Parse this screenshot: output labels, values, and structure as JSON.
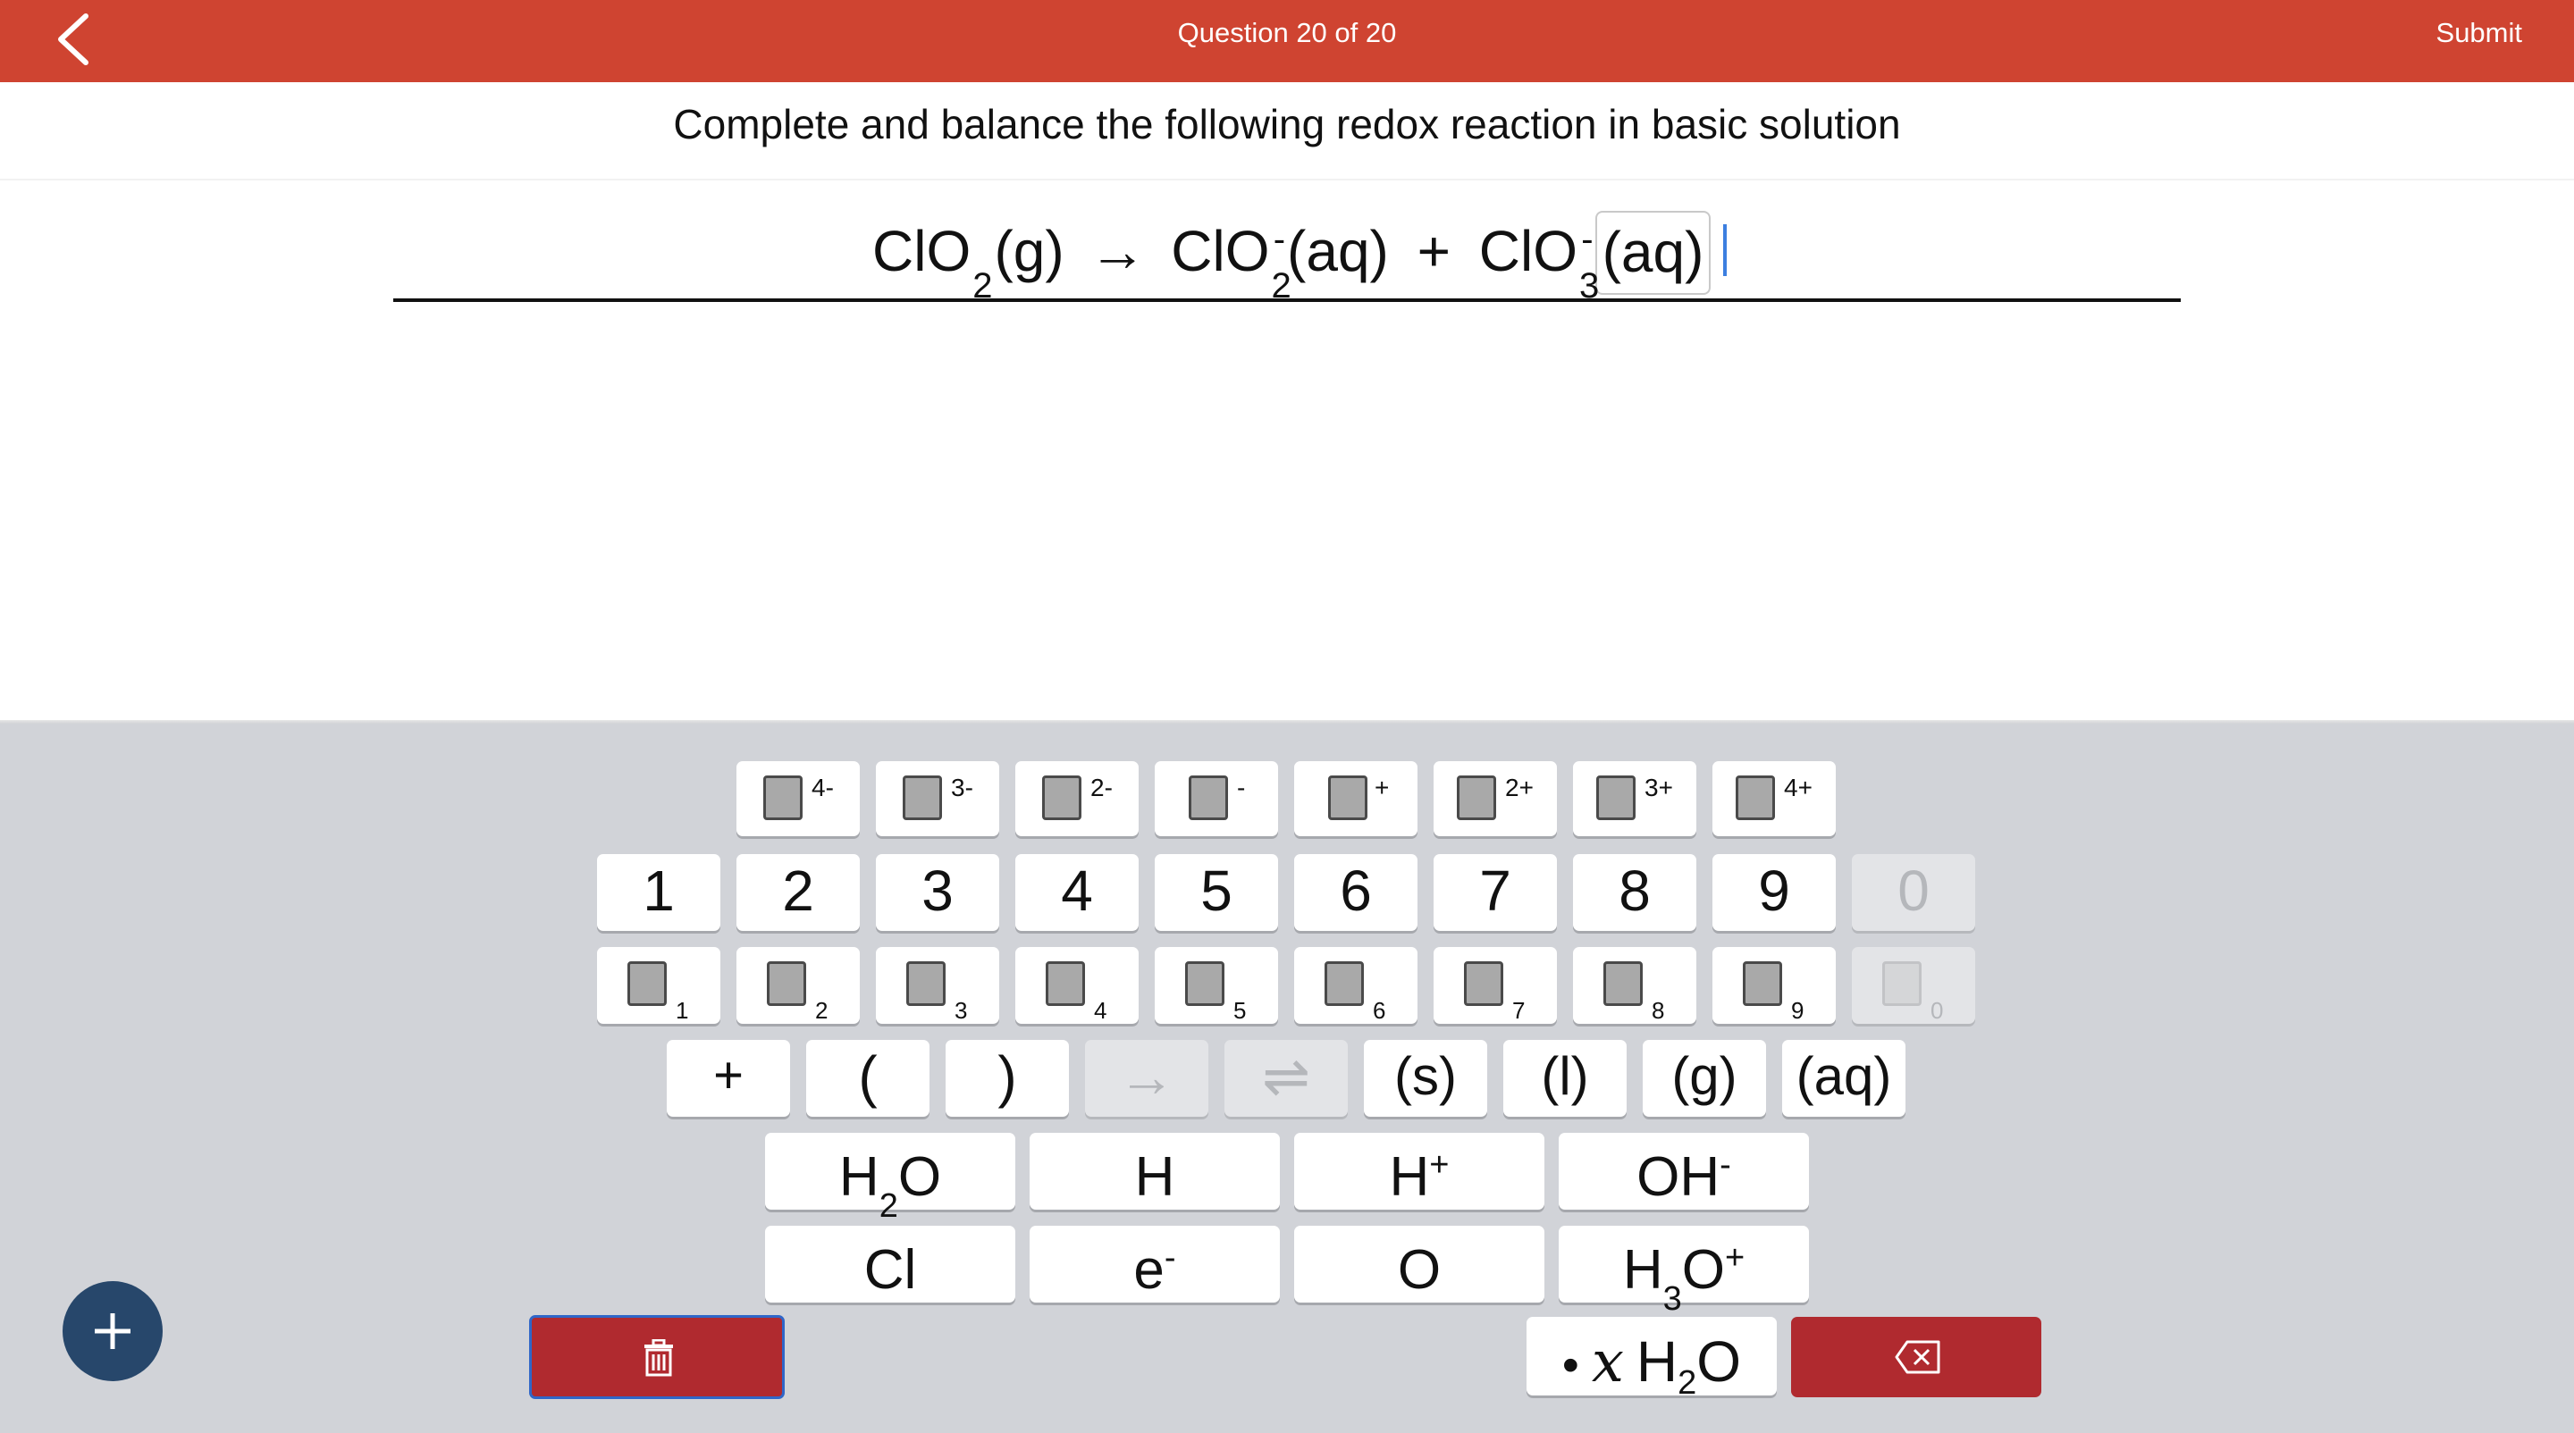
{
  "header": {
    "title": "Question 20 of 20",
    "submit_label": "Submit",
    "back_icon": "chevron-left-icon"
  },
  "question": {
    "instructions": "Complete and balance the following redox reaction in basic solution",
    "equation": {
      "reactant": {
        "formula": "ClO",
        "sub": "2",
        "state": "(g)"
      },
      "arrow": "→",
      "product1": {
        "formula": "ClO",
        "sub": "2",
        "sup": "-",
        "state": "(aq)"
      },
      "plus": "+",
      "product2": {
        "formula": "ClO",
        "sub": "3",
        "sup": "-",
        "state": "(aq)"
      }
    }
  },
  "keyboard": {
    "charges": [
      "4-",
      "3-",
      "2-",
      "-",
      "+",
      "2+",
      "3+",
      "4+"
    ],
    "digits": [
      "1",
      "2",
      "3",
      "4",
      "5",
      "6",
      "7",
      "8",
      "9",
      "0"
    ],
    "subscripts": [
      "1",
      "2",
      "3",
      "4",
      "5",
      "6",
      "7",
      "8",
      "9",
      "0"
    ],
    "symbols": {
      "plus": "+",
      "lparen": "(",
      "rparen": ")",
      "arrow": "→",
      "equilibrium": "⇌",
      "solid": "(s)",
      "liquid": "(l)",
      "gas": "(g)",
      "aqueous": "(aq)"
    },
    "species": {
      "water": {
        "main": "H",
        "sub": "2",
        "tail": "O"
      },
      "hydrogen": "H",
      "proton": {
        "main": "H",
        "sup": "+"
      },
      "hydroxide": {
        "main": "OH",
        "sup": "-"
      },
      "chlorine": "Cl",
      "electron": {
        "main": "e",
        "sup": "-"
      },
      "oxygen": "O",
      "hydronium": {
        "main": "H",
        "sub": "3",
        "tail": "O",
        "sup": "+"
      },
      "hydrate": {
        "bullet": "•",
        "x": "x",
        "main": "H",
        "sub": "2",
        "tail": "O"
      }
    },
    "trash_icon": "trash-icon",
    "backspace_icon": "backspace-icon",
    "add_icon": "plus-icon"
  },
  "colors": {
    "header_bg": "#cf4431",
    "keyboard_bg": "#d1d3d8",
    "action_red": "#b02a2f",
    "fab_blue": "#27476b",
    "caret_blue": "#3c7fe0"
  }
}
